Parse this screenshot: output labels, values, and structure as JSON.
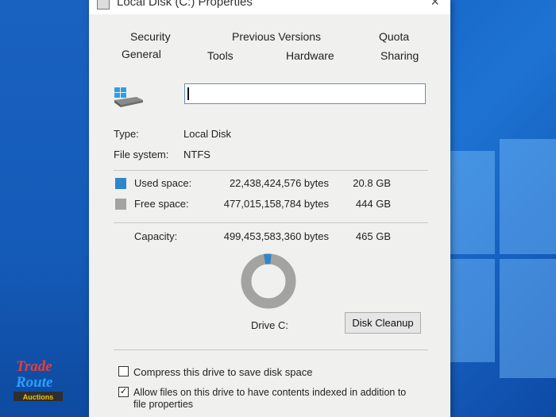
{
  "window": {
    "title": "Local Disk (C:) Properties",
    "close_glyph": "×"
  },
  "tabs": {
    "row1": [
      "Security",
      "Previous Versions",
      "Quota"
    ],
    "row2": [
      "General",
      "Tools",
      "Hardware",
      "Sharing"
    ]
  },
  "name_field": {
    "value": ""
  },
  "info": {
    "type_label": "Type:",
    "type_value": "Local Disk",
    "fs_label": "File system:",
    "fs_value": "NTFS"
  },
  "usage": {
    "used_label": "Used space:",
    "used_bytes": "22,438,424,576 bytes",
    "used_size": "20.8 GB",
    "free_label": "Free space:",
    "free_bytes": "477,015,158,784 bytes",
    "free_size": "444 GB",
    "capacity_label": "Capacity:",
    "capacity_bytes": "499,453,583,360 bytes",
    "capacity_size": "465 GB",
    "used_fraction": 0.045
  },
  "drive_label": "Drive C:",
  "disk_cleanup_label": "Disk Cleanup",
  "options": {
    "compress_label": "Compress this drive to save disk space",
    "compress_checked": false,
    "index_label_line1": "Allow files on this drive to have contents indexed in addition to",
    "index_label_line2": "file properties",
    "index_checked": true
  },
  "watermark": {
    "line1": "Trade",
    "line2": "Route",
    "line3": "Auctions"
  },
  "colors": {
    "used": "#2f86c8",
    "free": "#a3a3a1",
    "accent": "#0a3d8f"
  }
}
